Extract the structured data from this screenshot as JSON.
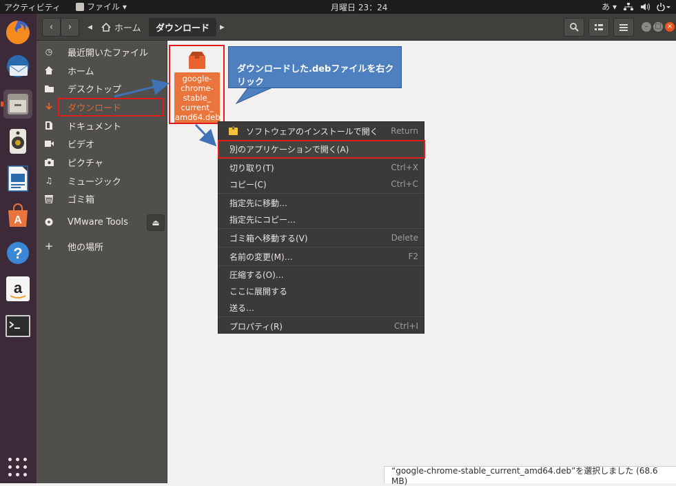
{
  "topbar": {
    "activities": "アクティビティ",
    "app_menu": "ファイル ▾",
    "clock": "月曜日 23：24",
    "input_method": "あ ▾",
    "network_icon": "network-icon",
    "volume_icon": "volume-icon",
    "power_icon": "power-icon"
  },
  "dock": {
    "items": [
      "firefox",
      "thunderbird",
      "files",
      "rhythmbox",
      "libreoffice-writer",
      "software-center",
      "help",
      "amazon",
      "terminal"
    ],
    "active": "files"
  },
  "headerbar": {
    "back_icon": "‹",
    "forward_icon": "›",
    "home_crumb": "ホーム",
    "current_crumb": "ダウンロード",
    "search_icon": "search-icon",
    "view_icon": "view-icon",
    "menu_icon": "menu-icon"
  },
  "sidebar": {
    "items": [
      {
        "icon": "recent-icon",
        "label": "最近開いたファイル"
      },
      {
        "icon": "home-icon",
        "label": "ホーム"
      },
      {
        "icon": "folder-icon",
        "label": "デスクトップ"
      },
      {
        "icon": "download-icon",
        "label": "ダウンロード"
      },
      {
        "icon": "document-icon",
        "label": "ドキュメント"
      },
      {
        "icon": "video-icon",
        "label": "ビデオ"
      },
      {
        "icon": "camera-icon",
        "label": "ピクチャ"
      },
      {
        "icon": "music-icon",
        "label": "ミュージック"
      },
      {
        "icon": "trash-icon",
        "label": "ゴミ箱"
      },
      {
        "icon": "disc-icon",
        "label": "VMware Tools"
      },
      {
        "icon": "plus-icon",
        "label": "他の場所"
      }
    ],
    "selected": "ダウンロード"
  },
  "file": {
    "name": "google-chrome-stable_current_amd64.deb",
    "lines": [
      "google-",
      "chrome-",
      "stable_",
      "current_",
      "amd64.deb"
    ]
  },
  "callout": {
    "text": "ダウンロードした.debファイルを右クリック"
  },
  "context_menu": {
    "items": [
      {
        "label": "ソフトウェアのインストールで開く",
        "accel": "Return"
      },
      {
        "label": "別のアプリケーションで開く(A)",
        "accel": ""
      },
      {
        "label": "切り取り(T)",
        "accel": "Ctrl+X"
      },
      {
        "label": "コピー(C)",
        "accel": "Ctrl+C"
      },
      {
        "label": "指定先に移動…",
        "accel": ""
      },
      {
        "label": "指定先にコピー…",
        "accel": ""
      },
      {
        "label": "ゴミ箱へ移動する(V)",
        "accel": "Delete"
      },
      {
        "label": "名前の変更(M)…",
        "accel": "F2"
      },
      {
        "label": "圧縮する(O)…",
        "accel": ""
      },
      {
        "label": "ここに展開する",
        "accel": ""
      },
      {
        "label": "送る…",
        "accel": ""
      },
      {
        "label": "プロパティ(R)",
        "accel": "Ctrl+I"
      }
    ]
  },
  "status": {
    "text": "“google-chrome-stable_current_amd64.deb”を選択しました (68.6 MB)"
  },
  "colors": {
    "accent": "#e95420",
    "highlight_box": "#e01b1b",
    "callout": "#4e7fbe",
    "dock": "#3c2a38"
  }
}
